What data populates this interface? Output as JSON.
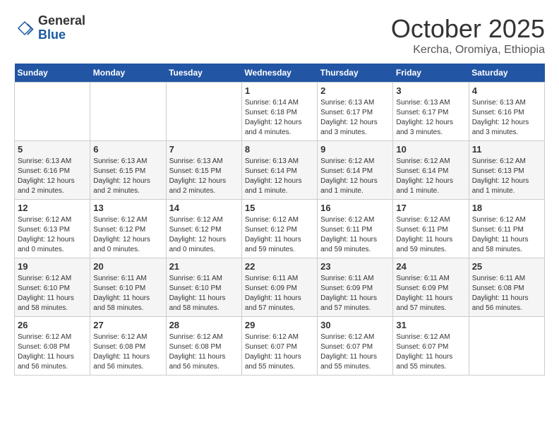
{
  "header": {
    "logo_general": "General",
    "logo_blue": "Blue",
    "month_title": "October 2025",
    "location": "Kercha, Oromiya, Ethiopia"
  },
  "days_of_week": [
    "Sunday",
    "Monday",
    "Tuesday",
    "Wednesday",
    "Thursday",
    "Friday",
    "Saturday"
  ],
  "weeks": [
    [
      {
        "day": "",
        "info": ""
      },
      {
        "day": "",
        "info": ""
      },
      {
        "day": "",
        "info": ""
      },
      {
        "day": "1",
        "info": "Sunrise: 6:14 AM\nSunset: 6:18 PM\nDaylight: 12 hours and 4 minutes."
      },
      {
        "day": "2",
        "info": "Sunrise: 6:13 AM\nSunset: 6:17 PM\nDaylight: 12 hours and 3 minutes."
      },
      {
        "day": "3",
        "info": "Sunrise: 6:13 AM\nSunset: 6:17 PM\nDaylight: 12 hours and 3 minutes."
      },
      {
        "day": "4",
        "info": "Sunrise: 6:13 AM\nSunset: 6:16 PM\nDaylight: 12 hours and 3 minutes."
      }
    ],
    [
      {
        "day": "5",
        "info": "Sunrise: 6:13 AM\nSunset: 6:16 PM\nDaylight: 12 hours and 2 minutes."
      },
      {
        "day": "6",
        "info": "Sunrise: 6:13 AM\nSunset: 6:15 PM\nDaylight: 12 hours and 2 minutes."
      },
      {
        "day": "7",
        "info": "Sunrise: 6:13 AM\nSunset: 6:15 PM\nDaylight: 12 hours and 2 minutes."
      },
      {
        "day": "8",
        "info": "Sunrise: 6:13 AM\nSunset: 6:14 PM\nDaylight: 12 hours and 1 minute."
      },
      {
        "day": "9",
        "info": "Sunrise: 6:12 AM\nSunset: 6:14 PM\nDaylight: 12 hours and 1 minute."
      },
      {
        "day": "10",
        "info": "Sunrise: 6:12 AM\nSunset: 6:14 PM\nDaylight: 12 hours and 1 minute."
      },
      {
        "day": "11",
        "info": "Sunrise: 6:12 AM\nSunset: 6:13 PM\nDaylight: 12 hours and 1 minute."
      }
    ],
    [
      {
        "day": "12",
        "info": "Sunrise: 6:12 AM\nSunset: 6:13 PM\nDaylight: 12 hours and 0 minutes."
      },
      {
        "day": "13",
        "info": "Sunrise: 6:12 AM\nSunset: 6:12 PM\nDaylight: 12 hours and 0 minutes."
      },
      {
        "day": "14",
        "info": "Sunrise: 6:12 AM\nSunset: 6:12 PM\nDaylight: 12 hours and 0 minutes."
      },
      {
        "day": "15",
        "info": "Sunrise: 6:12 AM\nSunset: 6:12 PM\nDaylight: 11 hours and 59 minutes."
      },
      {
        "day": "16",
        "info": "Sunrise: 6:12 AM\nSunset: 6:11 PM\nDaylight: 11 hours and 59 minutes."
      },
      {
        "day": "17",
        "info": "Sunrise: 6:12 AM\nSunset: 6:11 PM\nDaylight: 11 hours and 59 minutes."
      },
      {
        "day": "18",
        "info": "Sunrise: 6:12 AM\nSunset: 6:11 PM\nDaylight: 11 hours and 58 minutes."
      }
    ],
    [
      {
        "day": "19",
        "info": "Sunrise: 6:12 AM\nSunset: 6:10 PM\nDaylight: 11 hours and 58 minutes."
      },
      {
        "day": "20",
        "info": "Sunrise: 6:11 AM\nSunset: 6:10 PM\nDaylight: 11 hours and 58 minutes."
      },
      {
        "day": "21",
        "info": "Sunrise: 6:11 AM\nSunset: 6:10 PM\nDaylight: 11 hours and 58 minutes."
      },
      {
        "day": "22",
        "info": "Sunrise: 6:11 AM\nSunset: 6:09 PM\nDaylight: 11 hours and 57 minutes."
      },
      {
        "day": "23",
        "info": "Sunrise: 6:11 AM\nSunset: 6:09 PM\nDaylight: 11 hours and 57 minutes."
      },
      {
        "day": "24",
        "info": "Sunrise: 6:11 AM\nSunset: 6:09 PM\nDaylight: 11 hours and 57 minutes."
      },
      {
        "day": "25",
        "info": "Sunrise: 6:11 AM\nSunset: 6:08 PM\nDaylight: 11 hours and 56 minutes."
      }
    ],
    [
      {
        "day": "26",
        "info": "Sunrise: 6:12 AM\nSunset: 6:08 PM\nDaylight: 11 hours and 56 minutes."
      },
      {
        "day": "27",
        "info": "Sunrise: 6:12 AM\nSunset: 6:08 PM\nDaylight: 11 hours and 56 minutes."
      },
      {
        "day": "28",
        "info": "Sunrise: 6:12 AM\nSunset: 6:08 PM\nDaylight: 11 hours and 56 minutes."
      },
      {
        "day": "29",
        "info": "Sunrise: 6:12 AM\nSunset: 6:07 PM\nDaylight: 11 hours and 55 minutes."
      },
      {
        "day": "30",
        "info": "Sunrise: 6:12 AM\nSunset: 6:07 PM\nDaylight: 11 hours and 55 minutes."
      },
      {
        "day": "31",
        "info": "Sunrise: 6:12 AM\nSunset: 6:07 PM\nDaylight: 11 hours and 55 minutes."
      },
      {
        "day": "",
        "info": ""
      }
    ]
  ]
}
